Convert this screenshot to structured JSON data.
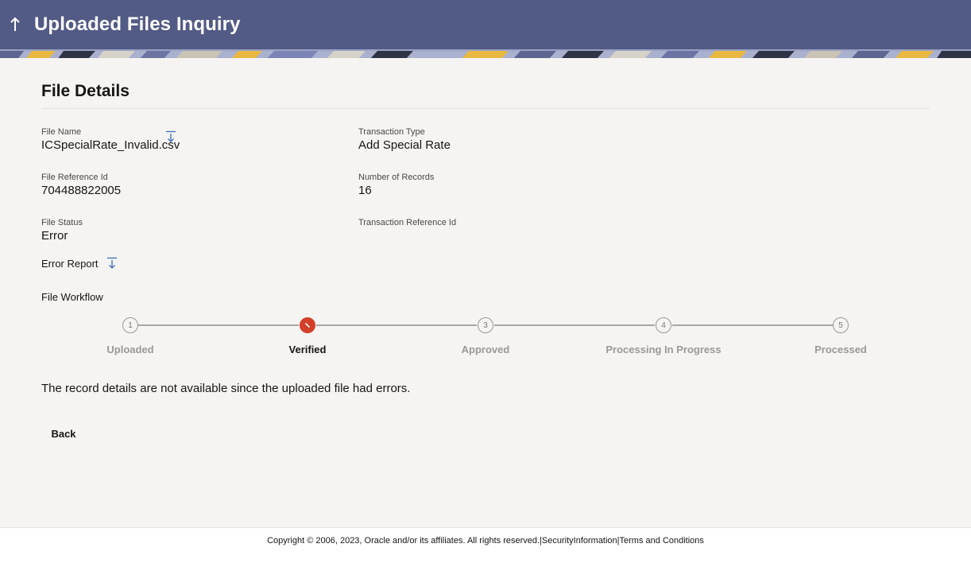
{
  "header": {
    "title": "Uploaded Files Inquiry",
    "back_icon": "up-arrow-icon",
    "color": "#525b85"
  },
  "file_details": {
    "section_title": "File Details",
    "fields": [
      {
        "label": "File Name",
        "value": "ICSpecialRate_Invalid.csv"
      },
      {
        "label": "Transaction Type",
        "value": "Add Special Rate"
      },
      {
        "label": "File Reference Id",
        "value": "704488822005"
      },
      {
        "label": "Number of Records",
        "value": "16"
      },
      {
        "label": "File Status",
        "value": "Error"
      },
      {
        "label": "Transaction Reference Id",
        "value": ""
      }
    ],
    "download_icon": "download-icon",
    "error_report_label": "Error Report"
  },
  "workflow": {
    "label": "File Workflow",
    "steps": [
      {
        "number": "1",
        "label": "Uploaded",
        "state": "done"
      },
      {
        "number": "",
        "label": "Verified",
        "state": "error",
        "icon": "error-icon"
      },
      {
        "number": "3",
        "label": "Approved",
        "state": "pending"
      },
      {
        "number": "4",
        "label": "Processing In Progress",
        "state": "pending"
      },
      {
        "number": "5",
        "label": "Processed",
        "state": "pending"
      }
    ],
    "error_color": "#d43f2a"
  },
  "message": "The record details are not available since the uploaded file had errors.",
  "actions": {
    "back_label": "Back"
  },
  "footer": {
    "copyright": "Copyright © 2006, 2023, Oracle and/or its affiliates. All rights reserved.|",
    "security_link": "SecurityInformation",
    "separator": "|",
    "terms_link": "Terms and Conditions"
  }
}
